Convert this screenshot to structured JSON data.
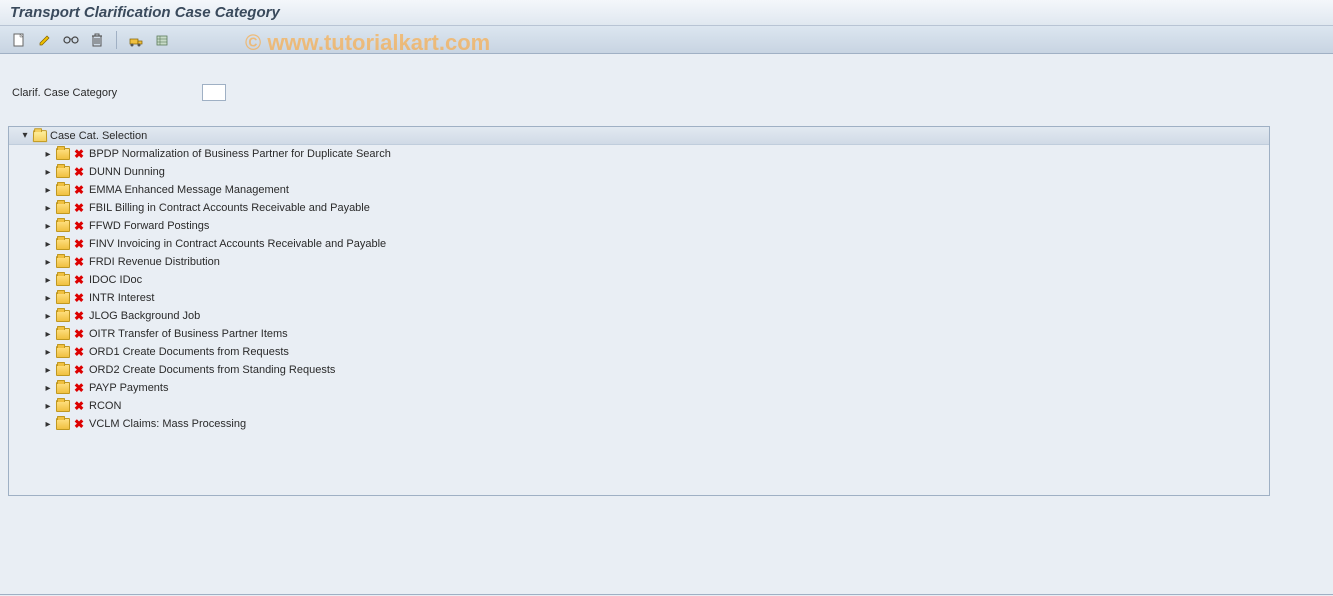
{
  "title": "Transport Clarification Case Category",
  "watermark": "© www.tutorialkart.com",
  "toolbar": {
    "new": "new-doc-icon",
    "edit": "pencil-icon",
    "glasses": "display-icon",
    "delete": "trash-icon",
    "transport": "transport-icon",
    "object": "object-icon"
  },
  "field": {
    "label": "Clarif. Case Category",
    "value": ""
  },
  "tree": {
    "root_label": "Case Cat. Selection",
    "items": [
      {
        "code": "BPDP",
        "desc": "Normalization of Business Partner for Duplicate Search"
      },
      {
        "code": "DUNN",
        "desc": "Dunning"
      },
      {
        "code": "EMMA",
        "desc": "Enhanced Message Management"
      },
      {
        "code": "FBIL",
        "desc": "Billing in Contract Accounts Receivable and Payable"
      },
      {
        "code": "FFWD",
        "desc": "Forward Postings"
      },
      {
        "code": "FINV",
        "desc": "Invoicing in Contract Accounts Receivable and Payable"
      },
      {
        "code": "FRDI",
        "desc": "Revenue Distribution"
      },
      {
        "code": "IDOC",
        "desc": "IDoc"
      },
      {
        "code": "INTR",
        "desc": "Interest"
      },
      {
        "code": "JLOG",
        "desc": "Background Job"
      },
      {
        "code": "OITR",
        "desc": "Transfer of Business Partner Items"
      },
      {
        "code": "ORD1",
        "desc": "Create Documents from Requests"
      },
      {
        "code": "ORD2",
        "desc": "Create Documents from Standing Requests"
      },
      {
        "code": "PAYP",
        "desc": "Payments"
      },
      {
        "code": "RCON",
        "desc": ""
      },
      {
        "code": "VCLM",
        "desc": "Claims: Mass Processing"
      }
    ]
  }
}
